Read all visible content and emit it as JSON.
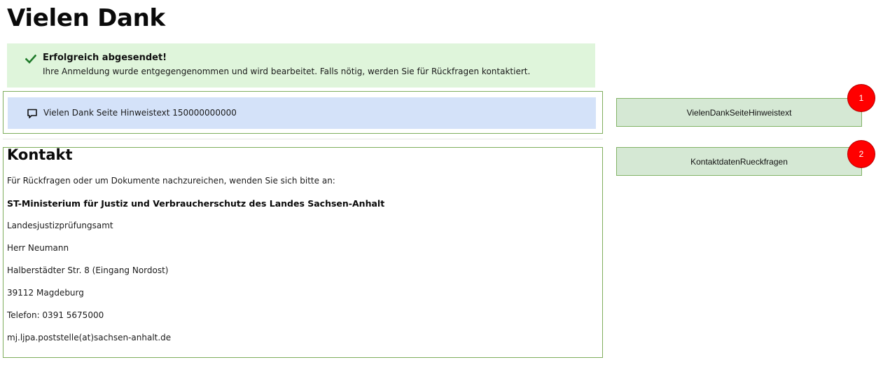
{
  "page": {
    "title": "Vielen Dank"
  },
  "success": {
    "title": "Erfolgreich abgesendet!",
    "text": "Ihre Anmeldung wurde entgegengenommen und wird bearbeitet. Falls nötig, werden Sie für Rückfragen kontaktiert.",
    "icon": "checkmark-icon",
    "color": "#1f7a2a"
  },
  "hint": {
    "text": "Vielen Dank Seite Hinweistext 150000000000",
    "icon": "speech-bubble-icon"
  },
  "contact": {
    "heading": "Kontakt",
    "intro": "Für Rückfragen oder um Dokumente nachzureichen, wenden Sie sich bitte an:",
    "organization": "ST-Ministerium für Justiz und Verbraucherschutz des Landes Sachsen-Anhalt",
    "department": "Landesjustizprüfungsamt",
    "person": "Herr Neumann",
    "street": "Halberstädter Str. 8 (Eingang Nordost)",
    "city": "39112 Magdeburg",
    "phone": "Telefon: 0391 5675000",
    "email": "mj.ljpa.poststelle(at)sachsen-anhalt.de"
  },
  "annotations": [
    {
      "label": "VielenDankSeiteHinweistext",
      "badge": "1"
    },
    {
      "label": "KontaktdatenRueckfragen",
      "badge": "2"
    }
  ],
  "colors": {
    "success_bg": "#dff5db",
    "hint_bg": "#d4e2f9",
    "frame_border": "#7fae5d",
    "annotation_bg": "#d5e8d4",
    "badge": "#ff0000"
  }
}
